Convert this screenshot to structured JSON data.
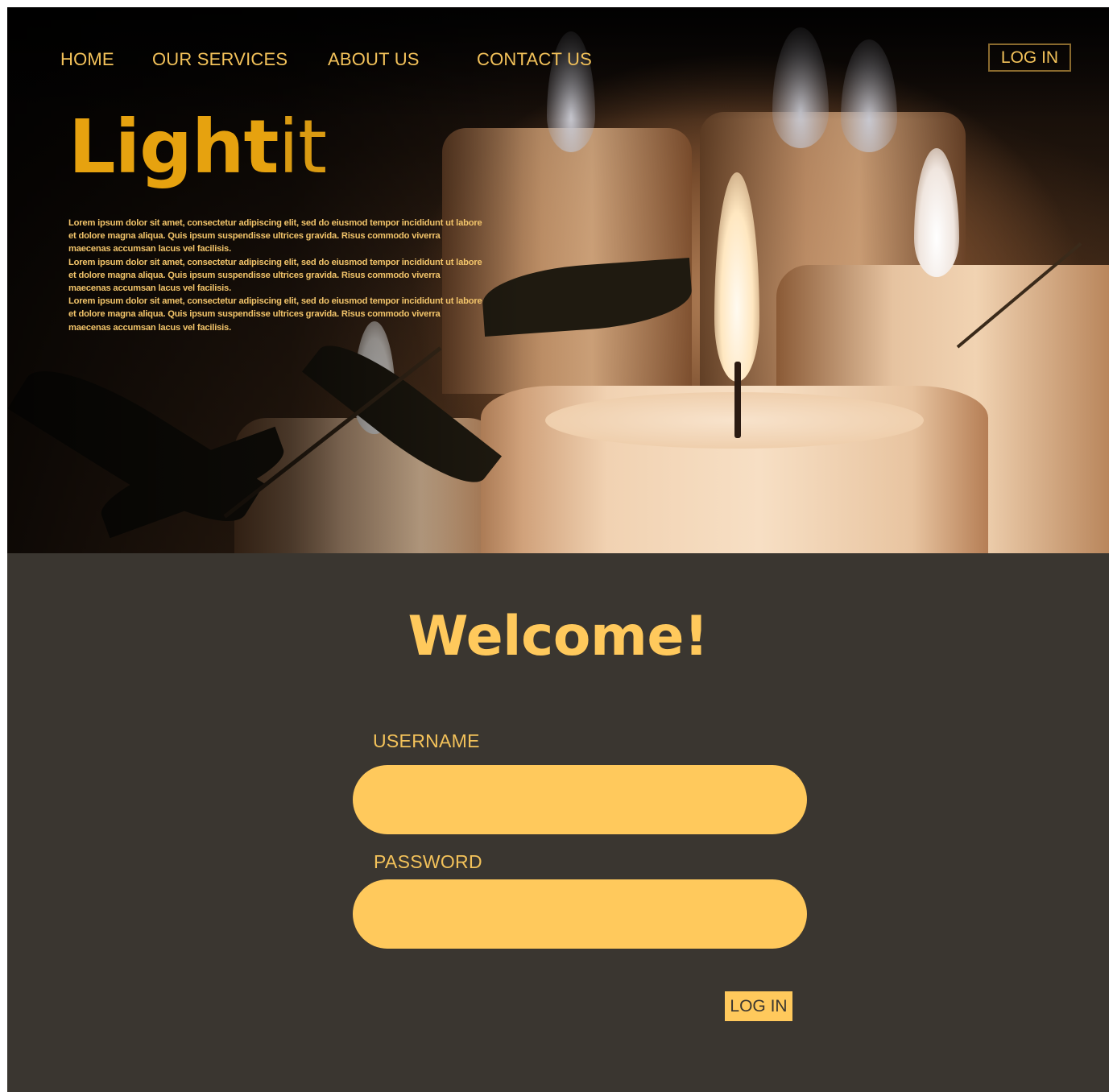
{
  "nav": {
    "items": [
      {
        "label": "HOME"
      },
      {
        "label": "OUR SERVICES"
      },
      {
        "label": "ABOUT US"
      },
      {
        "label": "CONTACT US"
      }
    ],
    "login_label": "LOG IN"
  },
  "hero": {
    "logo_bold": "Light",
    "logo_light": "it",
    "paragraphs": [
      "Lorem ipsum dolor sit amet, consectetur adipiscing elit, sed do eiusmod tempor incididunt ut labore et dolore magna aliqua. Quis ipsum suspendisse ultrices gravida. Risus commodo viverra maecenas accumsan lacus vel facilisis.",
      "Lorem ipsum dolor sit amet, consectetur adipiscing elit, sed do eiusmod tempor incididunt ut labore et dolore magna aliqua. Quis ipsum suspendisse ultrices gravida. Risus commodo viverra maecenas accumsan lacus vel facilisis.",
      "Lorem ipsum dolor sit amet, consectetur adipiscing elit, sed do eiusmod tempor incididunt ut labore et dolore magna aliqua. Quis ipsum suspendisse ultrices gravida. Risus commodo viverra maecenas accumsan lacus vel facilisis."
    ]
  },
  "login": {
    "title": "Welcome!",
    "username_label": "USERNAME",
    "username_value": "",
    "password_label": "PASSWORD",
    "password_value": "",
    "submit_label": "LOG IN"
  },
  "colors": {
    "background": "#3a3630",
    "accent": "#ffc95c",
    "logo": "#e6a20f"
  }
}
